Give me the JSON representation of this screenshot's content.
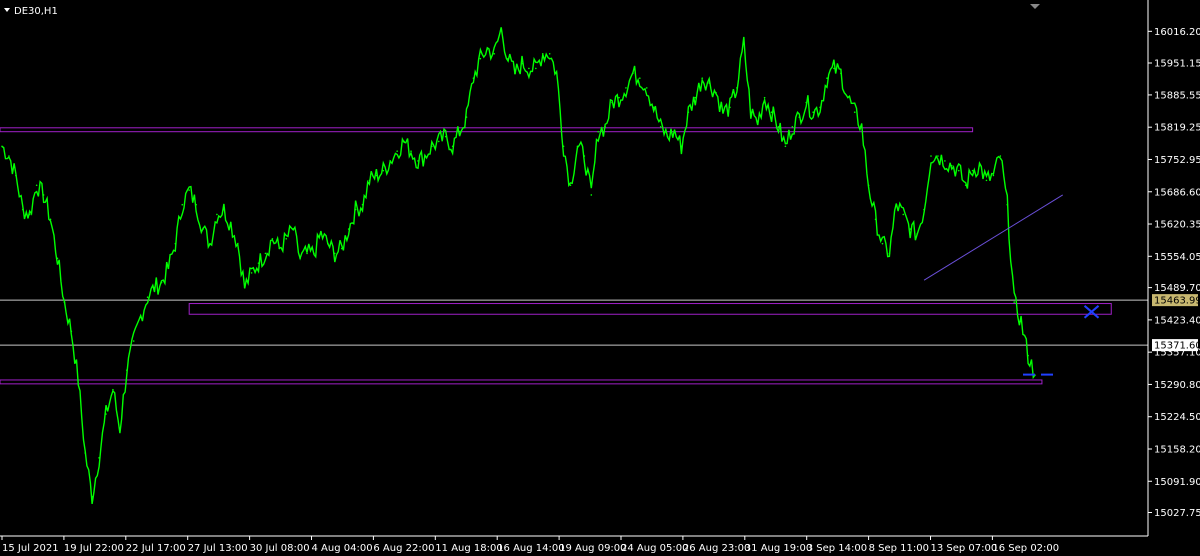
{
  "header": {
    "symbol": "DE30,H1"
  },
  "chart_data": {
    "type": "line",
    "title": "DE30,H1",
    "xlabel": "",
    "ylabel": "",
    "ylim": [
      15000,
      16060
    ],
    "grid": false,
    "colors": {
      "background": "#000000",
      "price": "#00ff00",
      "axis": "#ffffff",
      "zone": "#a020c8",
      "hline": "#c8c8c8",
      "trendline": "#6a4fd8",
      "marker": "#2040ff",
      "current_label_bg": "#c8b870"
    },
    "y_ticks": [
      "16016.20",
      "15951.15",
      "15885.55",
      "15819.25",
      "15752.95",
      "15686.60",
      "15620.35",
      "15554.05",
      "15489.70",
      "15423.40",
      "15357.10",
      "15290.80",
      "15224.50",
      "15158.20",
      "15091.90",
      "15027.75"
    ],
    "x_ticks": [
      "15 Jul 2021",
      "19 Jul 22:00",
      "22 Jul 17:00",
      "27 Jul 13:00",
      "30 Jul 08:00",
      "4 Aug 04:00",
      "6 Aug 22:00",
      "11 Aug 18:00",
      "16 Aug 14:00",
      "19 Aug 09:00",
      "24 Aug 05:00",
      "26 Aug 23:00",
      "31 Aug 19:00",
      "3 Sep 14:00",
      "8 Sep 11:00",
      "13 Sep 07:00",
      "16 Sep 02:00"
    ],
    "price_labels": [
      {
        "value": 15463.99,
        "text": "15463.99",
        "highlight": true
      },
      {
        "value": 15371.6,
        "text": "15371.60",
        "highlight": false
      }
    ],
    "series": [
      {
        "values": [
          15780,
          15760,
          15720,
          15650,
          15640,
          15700,
          15680,
          15630,
          15550,
          15460,
          15400,
          15300,
          15150,
          15060,
          15140,
          15230,
          15280,
          15200,
          15320,
          15380,
          15430,
          15470,
          15490,
          15500,
          15530,
          15580,
          15660,
          15690,
          15660,
          15610,
          15580,
          15640,
          15650,
          15620,
          15580,
          15490,
          15520,
          15540,
          15560,
          15590,
          15570,
          15590,
          15610,
          15550,
          15560,
          15560,
          15600,
          15580,
          15560,
          15570,
          15610,
          15650,
          15660,
          15710,
          15720,
          15730,
          15750,
          15770,
          15790,
          15770,
          15750,
          15760,
          15780,
          15790,
          15800,
          15780,
          15810,
          15840,
          15920,
          15960,
          15980,
          15970,
          16020,
          15960,
          15930,
          15950,
          15940,
          15940,
          15970,
          15970,
          15930,
          15780,
          15700,
          15780,
          15760,
          15680,
          15810,
          15820,
          15870,
          15880,
          15900,
          15930,
          15920,
          15900,
          15860,
          15820,
          15800,
          15810,
          15780,
          15850,
          15880,
          15920,
          15910,
          15890,
          15850,
          15860,
          15900,
          15990,
          15850,
          15830,
          15880,
          15850,
          15820,
          15780,
          15820,
          15840,
          15870,
          15850,
          15860,
          15920,
          15940,
          15930,
          15880,
          15850,
          15820,
          15700,
          15630,
          15580,
          15560,
          15660,
          15640,
          15610,
          15600,
          15650,
          15760,
          15760,
          15750,
          15740,
          15730,
          15700,
          15730,
          15740,
          15710,
          15720,
          15760,
          15660,
          15460,
          15420,
          15350,
          15310
        ]
      }
    ],
    "zones": [
      {
        "y1": 15818,
        "y2": 15810,
        "from_index": 0,
        "to_index": 140
      },
      {
        "y1": 15457,
        "y2": 15435,
        "from_index": 27,
        "to_index": 160
      },
      {
        "y1": 15300,
        "y2": 15292,
        "from_index": 0,
        "to_index": 150
      }
    ],
    "hlines": [
      15463.99,
      15371.6
    ],
    "trendline": {
      "from": {
        "index": 133,
        "value": 15505
      },
      "to": {
        "index": 153,
        "value": 15680
      }
    },
    "markers": [
      {
        "index": 156,
        "value": 15440
      }
    ],
    "dash_level": 15311
  }
}
